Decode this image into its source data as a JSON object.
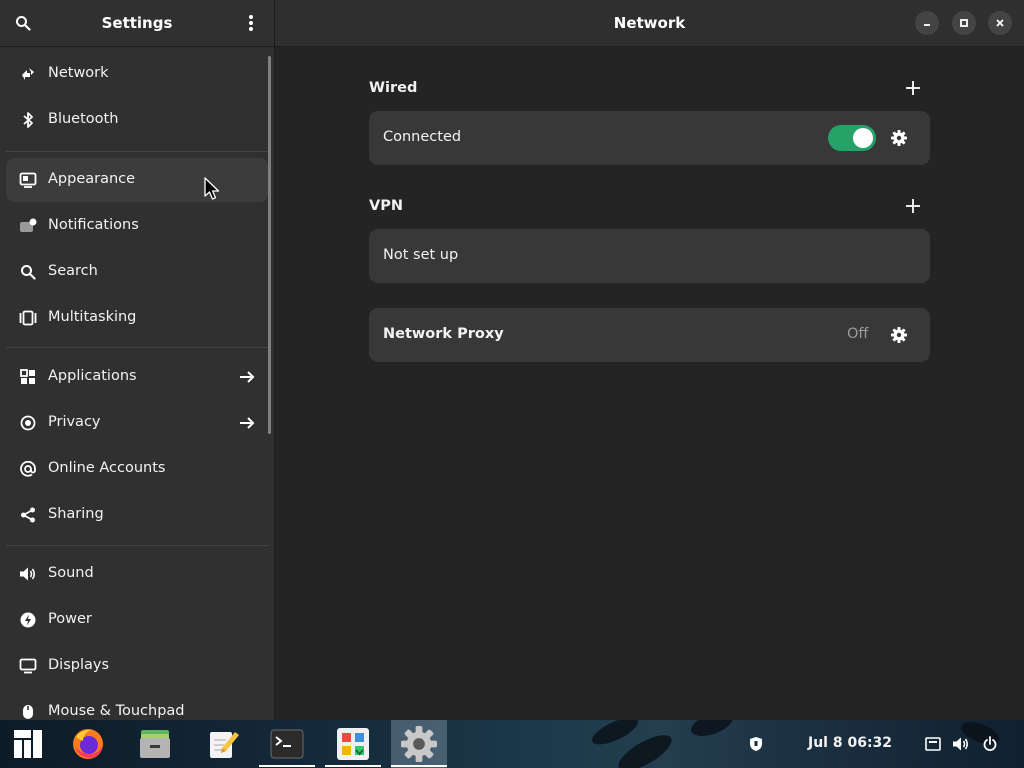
{
  "sidebar": {
    "title": "Settings",
    "items": [
      {
        "label": "Network",
        "icon": "network-icon"
      },
      {
        "label": "Bluetooth",
        "icon": "bluetooth-icon"
      },
      {
        "label": "Appearance",
        "icon": "appearance-icon",
        "selected": true
      },
      {
        "label": "Notifications",
        "icon": "notifications-icon"
      },
      {
        "label": "Search",
        "icon": "search-icon"
      },
      {
        "label": "Multitasking",
        "icon": "multitasking-icon"
      },
      {
        "label": "Applications",
        "icon": "applications-icon",
        "has_arrow": true
      },
      {
        "label": "Privacy",
        "icon": "privacy-icon",
        "has_arrow": true
      },
      {
        "label": "Online Accounts",
        "icon": "online-accounts-icon"
      },
      {
        "label": "Sharing",
        "icon": "sharing-icon"
      },
      {
        "label": "Sound",
        "icon": "sound-icon"
      },
      {
        "label": "Power",
        "icon": "power-icon"
      },
      {
        "label": "Displays",
        "icon": "displays-icon"
      },
      {
        "label": "Mouse & Touchpad",
        "icon": "mouse-icon"
      }
    ]
  },
  "main": {
    "title": "Network",
    "wired": {
      "title": "Wired",
      "connection_label": "Connected",
      "toggle_on": true
    },
    "vpn": {
      "title": "VPN",
      "status": "Not set up"
    },
    "proxy": {
      "label": "Network Proxy",
      "status": "Off"
    }
  },
  "taskbar": {
    "apps": [
      "manjaro-logo-icon",
      "firefox-icon",
      "files-icon",
      "text-editor-icon",
      "terminal-icon",
      "software-icon",
      "settings-icon"
    ],
    "clock": "Jul 8  06:32"
  },
  "colors": {
    "accent": "#26a269",
    "sidebar_bg": "#303030",
    "content_bg": "#242424",
    "card_bg": "#383838"
  }
}
